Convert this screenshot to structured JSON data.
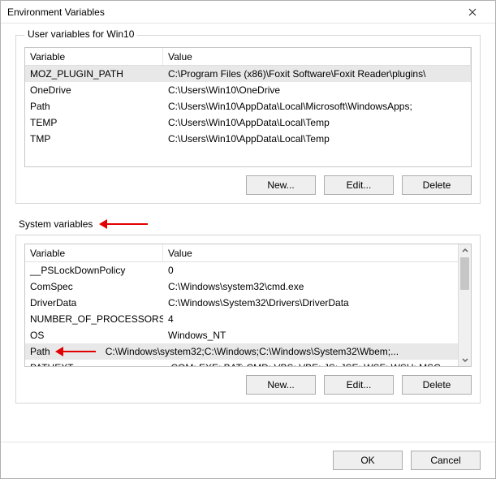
{
  "window": {
    "title": "Environment Variables"
  },
  "userGroup": {
    "label": "User variables for Win10",
    "headers": {
      "variable": "Variable",
      "value": "Value"
    },
    "rows": [
      {
        "variable": "MOZ_PLUGIN_PATH",
        "value": "C:\\Program Files (x86)\\Foxit Software\\Foxit Reader\\plugins\\",
        "selected": true
      },
      {
        "variable": "OneDrive",
        "value": "C:\\Users\\Win10\\OneDrive",
        "selected": false
      },
      {
        "variable": "Path",
        "value": "C:\\Users\\Win10\\AppData\\Local\\Microsoft\\WindowsApps;",
        "selected": false
      },
      {
        "variable": "TEMP",
        "value": "C:\\Users\\Win10\\AppData\\Local\\Temp",
        "selected": false
      },
      {
        "variable": "TMP",
        "value": "C:\\Users\\Win10\\AppData\\Local\\Temp",
        "selected": false
      }
    ],
    "buttons": {
      "new": "New...",
      "edit": "Edit...",
      "delete": "Delete"
    }
  },
  "systemGroup": {
    "label": "System variables",
    "headers": {
      "variable": "Variable",
      "value": "Value"
    },
    "rows": [
      {
        "variable": "__PSLockDownPolicy",
        "value": "0",
        "selected": false
      },
      {
        "variable": "ComSpec",
        "value": "C:\\Windows\\system32\\cmd.exe",
        "selected": false
      },
      {
        "variable": "DriverData",
        "value": "C:\\Windows\\System32\\Drivers\\DriverData",
        "selected": false
      },
      {
        "variable": "NUMBER_OF_PROCESSORS",
        "value": "4",
        "selected": false
      },
      {
        "variable": "OS",
        "value": "Windows_NT",
        "selected": false
      },
      {
        "variable": "Path",
        "value": "C:\\Windows\\system32;C:\\Windows;C:\\Windows\\System32\\Wbem;...",
        "selected": true,
        "arrow": true
      },
      {
        "variable": "PATHEXT",
        "value": ".COM;.EXE;.BAT;.CMD;.VBS;.VBE;.JS;.JSE;.WSF;.WSH;.MSC",
        "selected": false
      }
    ],
    "buttons": {
      "new": "New...",
      "edit": "Edit...",
      "delete": "Delete"
    }
  },
  "footer": {
    "ok": "OK",
    "cancel": "Cancel"
  }
}
